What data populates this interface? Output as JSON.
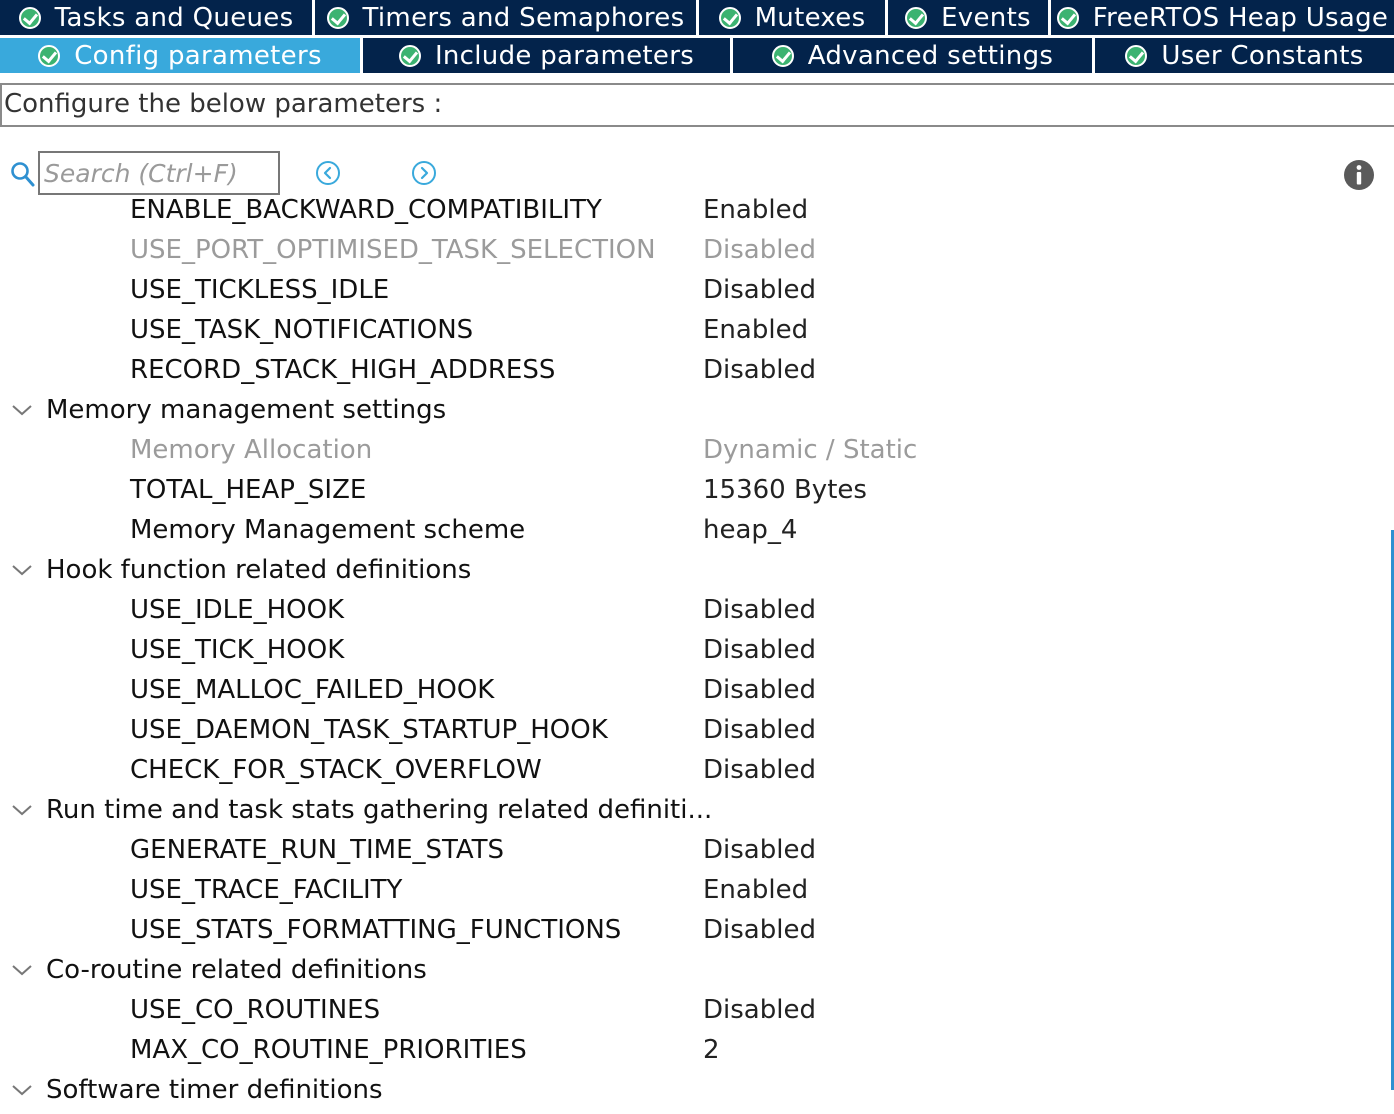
{
  "tabs_row1": [
    {
      "label": "Tasks and Queues"
    },
    {
      "label": "Timers and Semaphores"
    },
    {
      "label": "Mutexes"
    },
    {
      "label": "Events"
    },
    {
      "label": "FreeRTOS Heap Usage"
    }
  ],
  "tabs_row2": [
    {
      "label": "Config parameters",
      "active": true
    },
    {
      "label": "Include parameters"
    },
    {
      "label": "Advanced settings"
    },
    {
      "label": "User Constants"
    }
  ],
  "header": {
    "configure_text": "Configure the below parameters :"
  },
  "search": {
    "placeholder": "Search (Ctrl+F)",
    "value": ""
  },
  "icons": {
    "search": "search-icon",
    "prev": "circle-arrow-left-icon",
    "next": "circle-arrow-right-icon",
    "info": "info-icon",
    "expand": "chevron-down-icon",
    "tab_status": "check-circle-icon"
  },
  "colors": {
    "tab_bg": "#03234b",
    "tab_active_bg": "#39a9dc",
    "check_green": "#3cb371",
    "disabled_text": "#9b9b9b"
  },
  "tree": [
    {
      "type": "param",
      "name": "ENABLE_BACKWARD_COMPATIBILITY",
      "value": "Enabled"
    },
    {
      "type": "param",
      "name": "USE_PORT_OPTIMISED_TASK_SELECTION",
      "value": "Disabled",
      "disabled": true
    },
    {
      "type": "param",
      "name": "USE_TICKLESS_IDLE",
      "value": "Disabled"
    },
    {
      "type": "param",
      "name": "USE_TASK_NOTIFICATIONS",
      "value": "Enabled"
    },
    {
      "type": "param",
      "name": "RECORD_STACK_HIGH_ADDRESS",
      "value": "Disabled"
    },
    {
      "type": "group",
      "name": "Memory management settings"
    },
    {
      "type": "param",
      "name": "Memory Allocation",
      "value": "Dynamic / Static",
      "disabled": true
    },
    {
      "type": "param",
      "name": "TOTAL_HEAP_SIZE",
      "value": "15360 Bytes"
    },
    {
      "type": "param",
      "name": "Memory Management scheme",
      "value": "heap_4"
    },
    {
      "type": "group",
      "name": "Hook function related definitions"
    },
    {
      "type": "param",
      "name": "USE_IDLE_HOOK",
      "value": "Disabled"
    },
    {
      "type": "param",
      "name": "USE_TICK_HOOK",
      "value": "Disabled"
    },
    {
      "type": "param",
      "name": "USE_MALLOC_FAILED_HOOK",
      "value": "Disabled"
    },
    {
      "type": "param",
      "name": "USE_DAEMON_TASK_STARTUP_HOOK",
      "value": "Disabled"
    },
    {
      "type": "param",
      "name": "CHECK_FOR_STACK_OVERFLOW",
      "value": "Disabled"
    },
    {
      "type": "group",
      "name": "Run time and task stats gathering related definiti..."
    },
    {
      "type": "param",
      "name": "GENERATE_RUN_TIME_STATS",
      "value": "Disabled"
    },
    {
      "type": "param",
      "name": "USE_TRACE_FACILITY",
      "value": "Enabled"
    },
    {
      "type": "param",
      "name": "USE_STATS_FORMATTING_FUNCTIONS",
      "value": "Disabled"
    },
    {
      "type": "group",
      "name": "Co-routine related definitions"
    },
    {
      "type": "param",
      "name": "USE_CO_ROUTINES",
      "value": "Disabled"
    },
    {
      "type": "param",
      "name": "MAX_CO_ROUTINE_PRIORITIES",
      "value": "2"
    },
    {
      "type": "group",
      "name": "Software timer definitions"
    }
  ]
}
